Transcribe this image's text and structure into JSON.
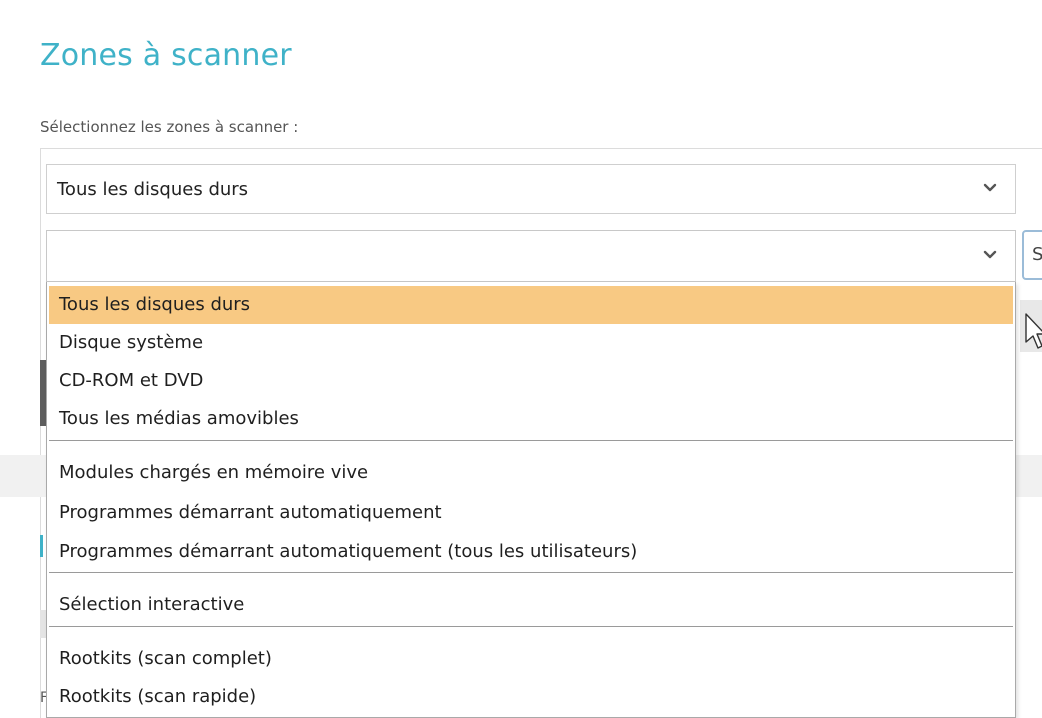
{
  "page": {
    "title": "Zones à scanner",
    "subtitle": "Sélectionnez les zones à scanner :",
    "accent_color": "#3fb2c8"
  },
  "select_primary": {
    "value": "Tous les disques durs",
    "icon": "chevron-down-icon"
  },
  "select_secondary": {
    "value": "",
    "icon": "chevron-down-icon",
    "side_button_label": "S"
  },
  "dropdown": {
    "highlight_color": "#f8c983",
    "options": [
      {
        "label": "Tous les disques durs",
        "selected": true
      },
      {
        "label": "Disque système"
      },
      {
        "label": "CD-ROM et DVD"
      },
      {
        "label": "Tous les médias amovibles"
      },
      {
        "label": "Modules chargés en mémoire vive"
      },
      {
        "label": "Programmes démarrant automatiquement"
      },
      {
        "label": "Programmes démarrant automatiquement (tous les utilisateurs)"
      },
      {
        "label": "Sélection interactive"
      },
      {
        "label": "Rootkits (scan complet)"
      },
      {
        "label": "Rootkits (scan rapide)"
      }
    ]
  },
  "background": {
    "bottom_left_char": "F"
  }
}
